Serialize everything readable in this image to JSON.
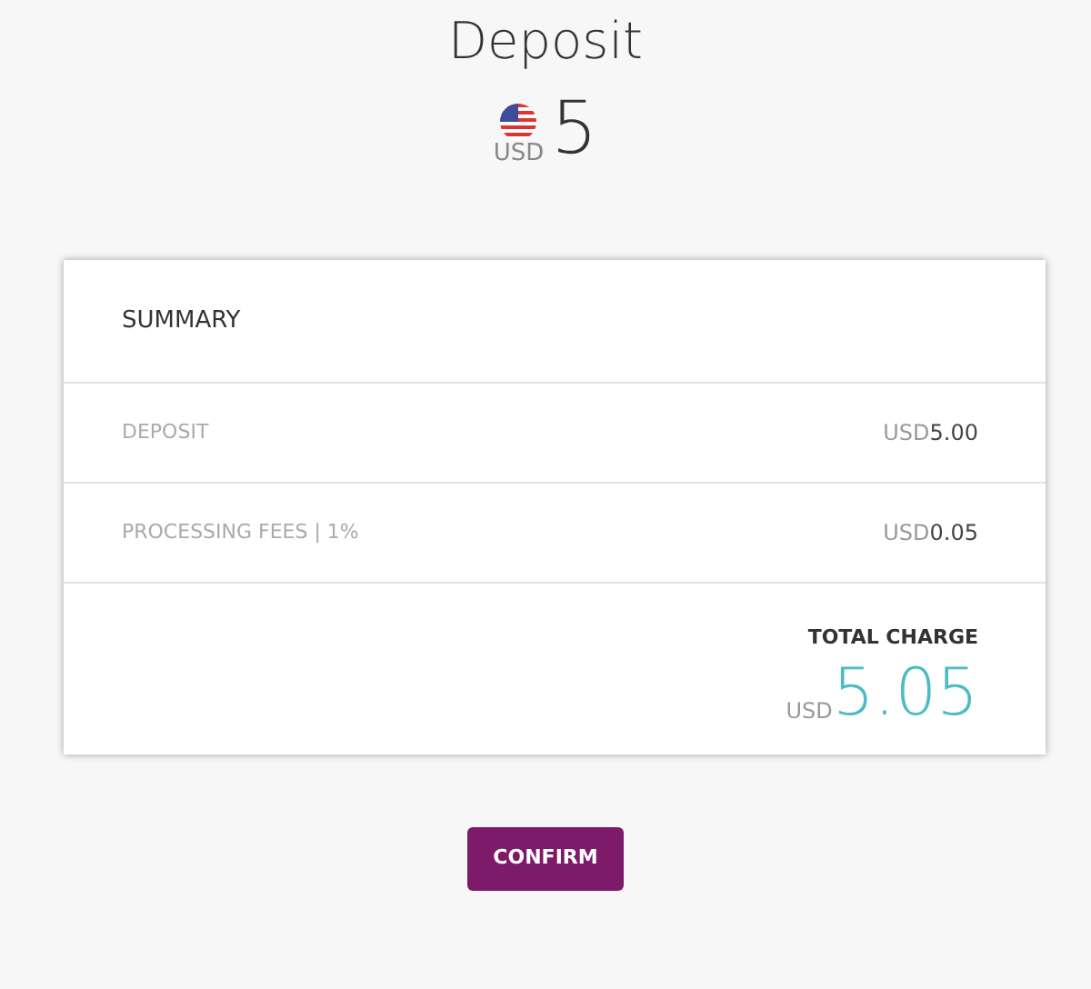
{
  "title": "Deposit",
  "amount": {
    "currency": "USD",
    "value": "5"
  },
  "summary": {
    "heading": "SUMMARY",
    "rows": [
      {
        "label": "DEPOSIT",
        "currency": "USD",
        "value": "5.00"
      },
      {
        "label": "PROCESSING FEES | 1%",
        "currency": "USD",
        "value": "0.05"
      }
    ],
    "total": {
      "label": "TOTAL CHARGE",
      "currency": "USD",
      "value": "5.05"
    }
  },
  "button": "CONFIRM"
}
